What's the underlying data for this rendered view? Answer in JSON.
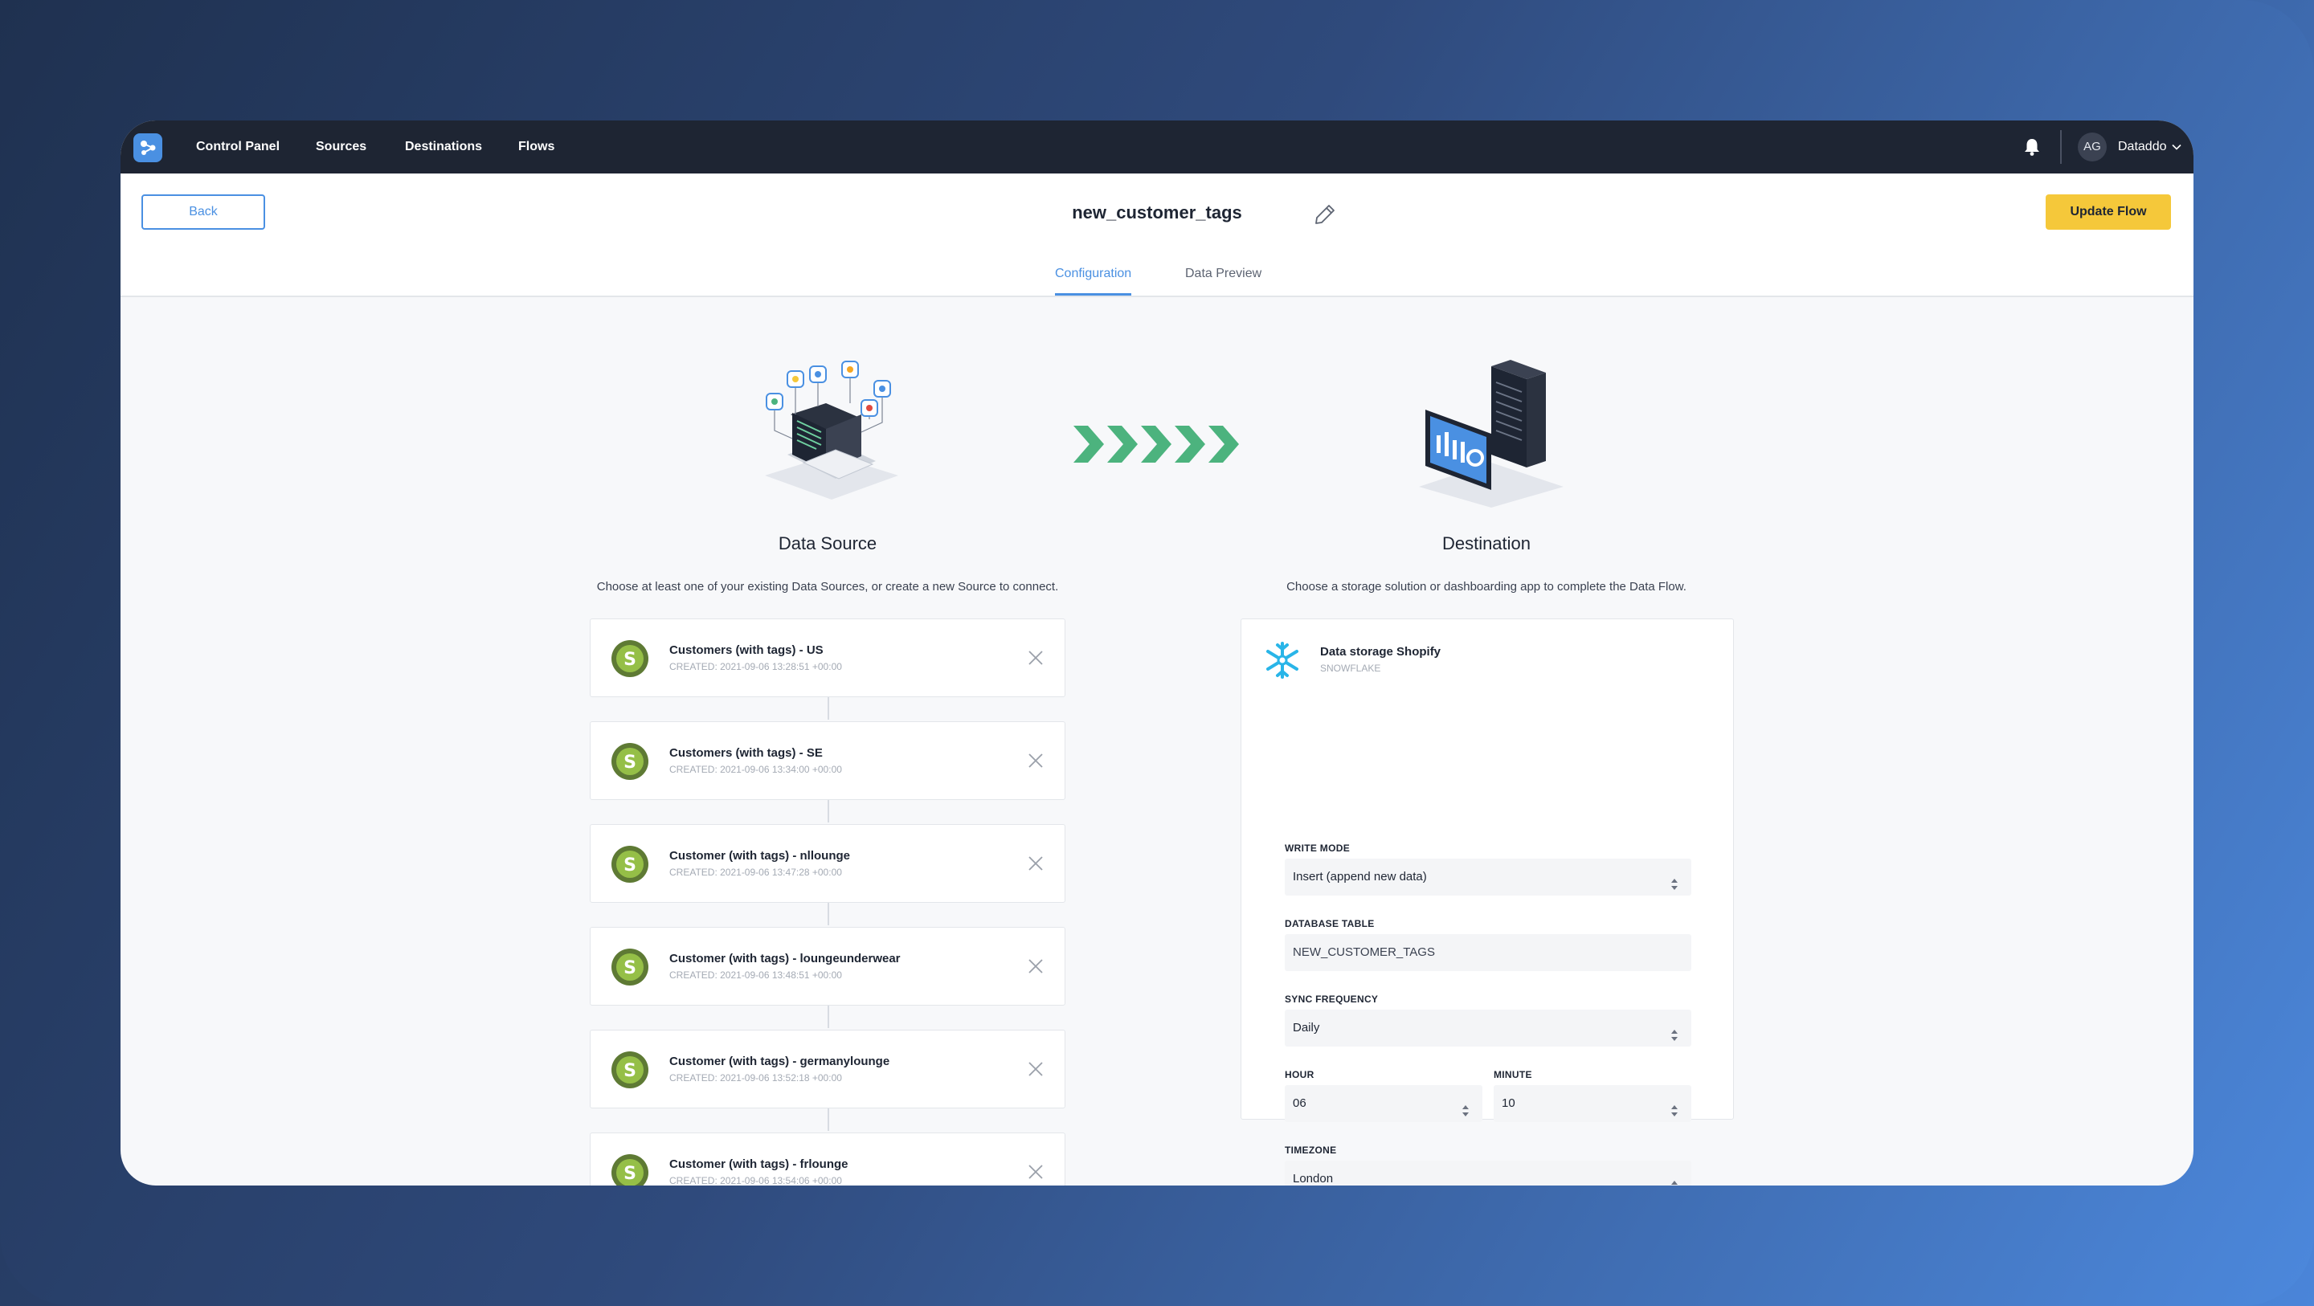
{
  "nav": {
    "items": [
      "Control Panel",
      "Sources",
      "Destinations",
      "Flows"
    ],
    "user": {
      "initials": "AG",
      "name": "Dataddo"
    }
  },
  "header": {
    "back_label": "Back",
    "flow_name": "new_customer_tags",
    "update_label": "Update Flow"
  },
  "tabs": [
    {
      "label": "Configuration",
      "active": true
    },
    {
      "label": "Data Preview",
      "active": false
    }
  ],
  "source": {
    "title": "Data Source",
    "description": "Choose at least one of your existing Data Sources, or create a new Source to connect.",
    "items": [
      {
        "name": "Customers (with tags) - US",
        "created": "CREATED: 2021-09-06 13:28:51 +00:00"
      },
      {
        "name": "Customers (with tags) - SE",
        "created": "CREATED: 2021-09-06 13:34:00 +00:00"
      },
      {
        "name": "Customer (with tags) - nllounge",
        "created": "CREATED: 2021-09-06 13:47:28 +00:00"
      },
      {
        "name": "Customer (with tags) - loungeunderwear",
        "created": "CREATED: 2021-09-06 13:48:51 +00:00"
      },
      {
        "name": "Customer (with tags) - germanylounge",
        "created": "CREATED: 2021-09-06 13:52:18 +00:00"
      },
      {
        "name": "Customer (with tags) - frlounge",
        "created": "CREATED: 2021-09-06 13:54:06 +00:00"
      }
    ]
  },
  "destination": {
    "title": "Destination",
    "description": "Choose a storage solution or dashboarding app to complete the Data Flow.",
    "name": "Data storage Shopify",
    "type": "SNOWFLAKE",
    "fields": {
      "write_mode": {
        "label": "WRITE MODE",
        "value": "Insert (append new data)"
      },
      "database_table": {
        "label": "DATABASE TABLE",
        "value": "NEW_CUSTOMER_TAGS"
      },
      "sync_frequency": {
        "label": "SYNC FREQUENCY",
        "value": "Daily"
      },
      "hour": {
        "label": "HOUR",
        "value": "06"
      },
      "minute": {
        "label": "MINUTE",
        "value": "10"
      },
      "timezone": {
        "label": "TIMEZONE",
        "value": "London"
      }
    }
  },
  "colors": {
    "accent": "#4a90e2",
    "update_button": "#f5c83a",
    "nav_bg": "#1e2533",
    "arrow_green": "#4cb37e",
    "shopify_green": "#95bf47"
  },
  "icons": [
    "app-logo-icon",
    "bell-icon",
    "chevron-down-icon",
    "pencil-icon",
    "shopify-icon",
    "close-icon",
    "snowflake-icon",
    "select-arrows-icon"
  ]
}
